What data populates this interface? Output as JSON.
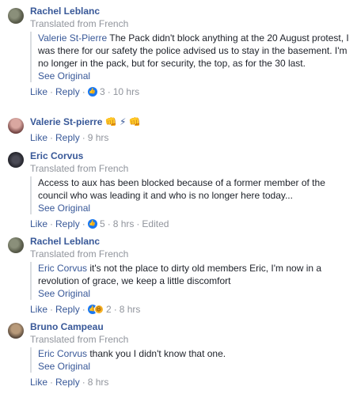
{
  "comments": [
    {
      "author": "Rachel Leblanc",
      "translated": "Translated from French",
      "mention": "Valerie St-Pierre",
      "text": " The Pack didn't block anything at the 20 August protest, I was there for our safety the police advised us to stay in the basement. I'm no longer in the pack, but for security, the top, as for the 30 last.",
      "see_original": "See Original",
      "like": "Like",
      "reply": "Reply",
      "reaction_count": "3",
      "time": "10 hrs"
    },
    {
      "author": "Valerie St-pierre",
      "emojis": "👊 ⚡ 👊",
      "like": "Like",
      "reply": "Reply",
      "time": "9 hrs"
    },
    {
      "author": "Eric Corvus",
      "translated": "Translated from French",
      "text": "Access to aux has been blocked because of a former member of the council who was leading it and who is no longer here today...",
      "see_original": "See Original",
      "like": "Like",
      "reply": "Reply",
      "reaction_count": "5",
      "time": "8 hrs",
      "edited": "Edited"
    },
    {
      "author": "Rachel Leblanc",
      "translated": "Translated from French",
      "mention": "Eric Corvus",
      "text": " it's not the place to dirty old members Eric, I'm now in a revolution of grace, we keep a little discomfort",
      "see_original": "See Original",
      "like": "Like",
      "reply": "Reply",
      "reaction_count": "2",
      "time": "8 hrs"
    },
    {
      "author": "Bruno Campeau",
      "translated": "Translated from French",
      "mention": "Eric Corvus",
      "text": " thank you I didn't know that one.",
      "see_original": "See Original",
      "like": "Like",
      "reply": "Reply",
      "time": "8 hrs"
    }
  ],
  "sep": "·",
  "icons": {
    "like_reaction": "thumbs-up-icon",
    "haha_reaction": "laughing-face-icon"
  },
  "colors": {
    "link": "#385898",
    "meta": "#90949c",
    "like_blue": "#1877f2"
  }
}
